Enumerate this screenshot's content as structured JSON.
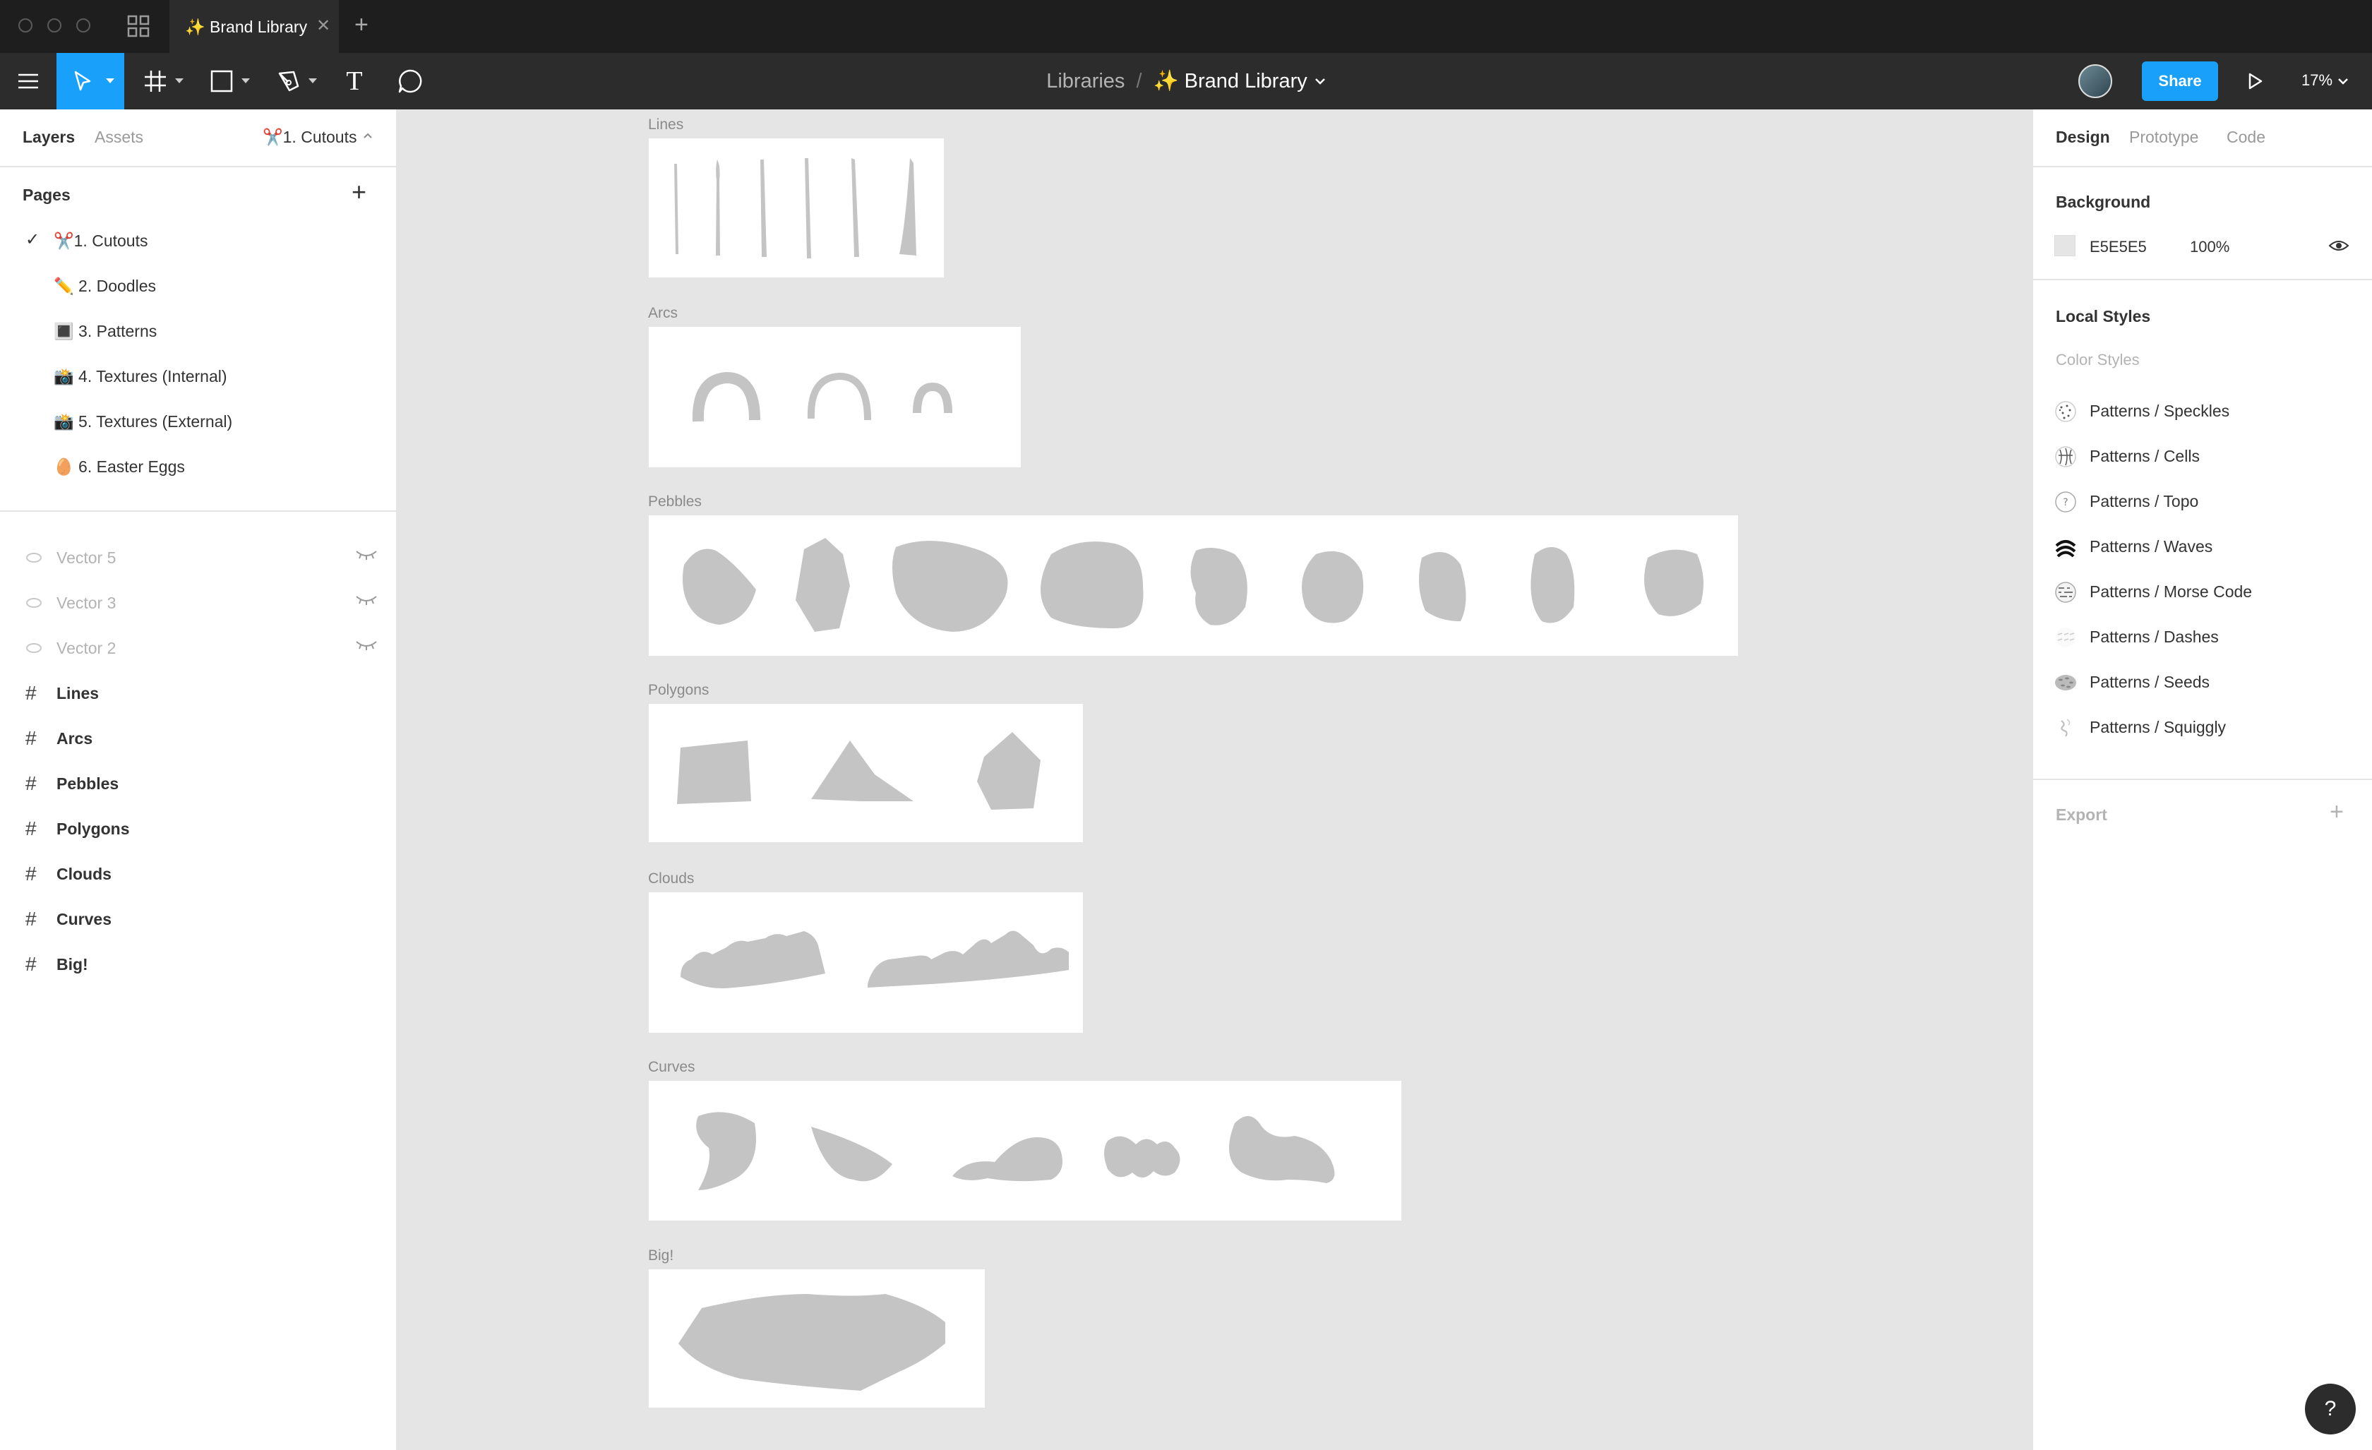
{
  "window": {
    "tab_title": "✨ Brand Library",
    "tab_close": "✕",
    "new_tab": "+"
  },
  "toolbar": {
    "breadcrumb_parent": "Libraries",
    "breadcrumb_sep": "/",
    "file_name": "✨ Brand Library",
    "share_label": "Share",
    "zoom": "17%",
    "text_tool": "T"
  },
  "left_panel": {
    "tabs": {
      "layers": "Layers",
      "assets": "Assets",
      "current_page": "✂️1. Cutouts"
    },
    "pages_header": "Pages",
    "add_page": "+",
    "check_mark": "✓",
    "pages": [
      {
        "label": "✂️1. Cutouts",
        "selected": true
      },
      {
        "label": "✏️ 2. Doodles",
        "selected": false
      },
      {
        "label": "🔳 3. Patterns",
        "selected": false
      },
      {
        "label": "📸 4. Textures (Internal)",
        "selected": false
      },
      {
        "label": "📸 5. Textures (External)",
        "selected": false
      },
      {
        "label": "🥚 6. Easter Eggs",
        "selected": false
      }
    ],
    "hidden_layers": [
      "Vector 5",
      "Vector 3",
      "Vector 2"
    ],
    "frame_layers": [
      "Lines",
      "Arcs",
      "Pebbles",
      "Polygons",
      "Clouds",
      "Curves",
      "Big!"
    ],
    "frame_icon": "#"
  },
  "canvas": {
    "frames": [
      {
        "label": "Lines"
      },
      {
        "label": "Arcs"
      },
      {
        "label": "Pebbles"
      },
      {
        "label": "Polygons"
      },
      {
        "label": "Clouds"
      },
      {
        "label": "Curves"
      },
      {
        "label": "Big!"
      }
    ],
    "shape_color": "#c4c4c4"
  },
  "right_panel": {
    "tabs": {
      "design": "Design",
      "prototype": "Prototype",
      "code": "Code"
    },
    "background_header": "Background",
    "background_hex": "E5E5E5",
    "background_opacity": "100%",
    "background_color": "#e5e5e5",
    "local_styles_header": "Local Styles",
    "color_styles_label": "Color Styles",
    "styles": [
      {
        "name": "Patterns / Speckles",
        "icon": "speckles-swatch-icon"
      },
      {
        "name": "Patterns / Cells",
        "icon": "cells-swatch-icon"
      },
      {
        "name": "Patterns / Topo",
        "icon": "topo-swatch-icon"
      },
      {
        "name": "Patterns / Waves",
        "icon": "waves-swatch-icon"
      },
      {
        "name": "Patterns / Morse Code",
        "icon": "morse-swatch-icon"
      },
      {
        "name": "Patterns / Dashes",
        "icon": "dashes-swatch-icon"
      },
      {
        "name": "Patterns / Seeds",
        "icon": "seeds-swatch-icon"
      },
      {
        "name": "Patterns / Squiggly",
        "icon": "squiggly-swatch-icon"
      }
    ],
    "export_label": "Export",
    "export_add": "+"
  },
  "help": "?"
}
